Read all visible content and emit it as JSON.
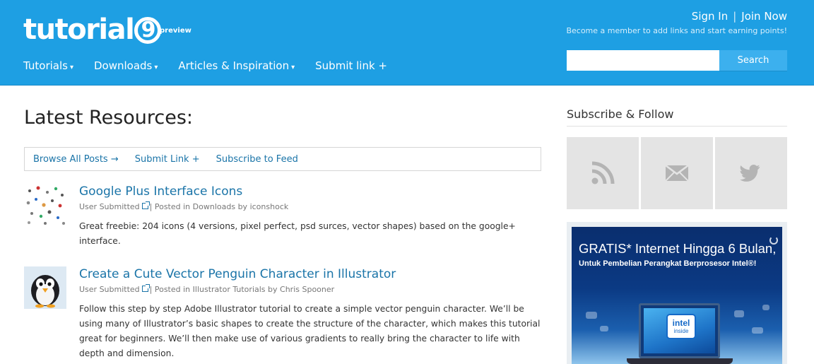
{
  "header": {
    "logo_text": "tutorial",
    "logo_nine": "9",
    "logo_badge": "preview",
    "nav": [
      {
        "label": "Tutorials",
        "caret": "▾"
      },
      {
        "label": "Downloads",
        "caret": "▾"
      },
      {
        "label": "Articles & Inspiration",
        "caret": "▾"
      },
      {
        "label": "Submit link +",
        "caret": ""
      }
    ],
    "sign_in": "Sign In",
    "separator": "|",
    "join_now": "Join Now",
    "tagline": "Become a member to add links and start earning points!",
    "search": {
      "placeholder": "",
      "value": "",
      "button_label": "Search"
    }
  },
  "main": {
    "title": "Latest Resources:",
    "filters": [
      "Browse All Posts →",
      "Submit Link +",
      "Subscribe to Feed"
    ],
    "posts": [
      {
        "title": "Google Plus Interface Icons",
        "submitted": "User Submitted",
        "posted_in_prefix": "| Posted in ",
        "category": "Downloads",
        "by": " by ",
        "author": "iconshock",
        "excerpt": "Great freebie: 204 icons (4 versions, pixel perfect, psd surces, vector shapes) based on the google+ interface."
      },
      {
        "title": "Create a Cute Vector Penguin Character in Illustrator",
        "submitted": "User Submitted",
        "posted_in_prefix": "| Posted in ",
        "category": "Illustrator Tutorials",
        "by": " by ",
        "author": "Chris Spooner",
        "excerpt": "Follow this step by step Adobe Illustrator tutorial to create a simple vector penguin character. We’ll be using many of Illustrator’s basic shapes to create the structure of the character, which makes this tutorial great for beginners. We’ll then make use of various gradients to really bring the character to life with depth and dimension."
      }
    ]
  },
  "sidebar": {
    "title": "Subscribe & Follow",
    "social": [
      "rss-icon",
      "email-icon",
      "twitter-bird-icon"
    ],
    "ad": {
      "headline": "GRATIS* Internet Hingga 6 Bulan,",
      "subline": "Untuk Pembelian Perangkat Berprosesor Intel®!",
      "intel_word": "intel",
      "intel_inside": "inside"
    }
  },
  "colors": {
    "header_bg": "#1e9fe3",
    "link": "#1a74a8",
    "tile_bg": "#e4e4e4",
    "tile_icon": "#b4b4b4"
  }
}
